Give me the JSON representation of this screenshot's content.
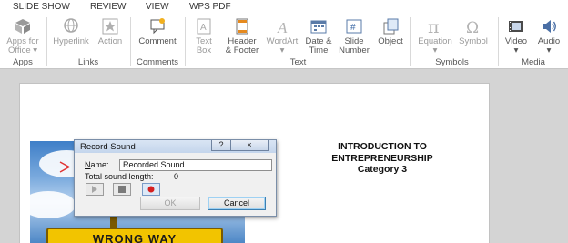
{
  "tabs": [
    "SLIDE SHOW",
    "REVIEW",
    "VIEW",
    "WPS PDF"
  ],
  "ribbon": {
    "apps": {
      "label": "Apps for Office",
      "label_line1": "Apps for",
      "label_line2": "Office",
      "arrow": "▾",
      "group": "Apps"
    },
    "links": {
      "hyperlink": "Hyperlink",
      "action": "Action",
      "group": "Links"
    },
    "comments": {
      "comment": "Comment",
      "group": "Comments"
    },
    "text": {
      "text_box_1": "Text",
      "text_box_2": "Box",
      "header_1": "Header",
      "header_2": "& Footer",
      "wordart": "WordArt",
      "wordart_arrow": "▾",
      "datetime_1": "Date &",
      "datetime_2": "Time",
      "slide_1": "Slide",
      "slide_2": "Number",
      "object": "Object",
      "group": "Text"
    },
    "symbols": {
      "equation": "Equation",
      "equation_arrow": "▾",
      "symbol": "Symbol",
      "group": "Symbols"
    },
    "media": {
      "video": "Video",
      "video_arrow": "▾",
      "audio": "Audio",
      "audio_arrow": "▾",
      "group": "Media"
    }
  },
  "slide": {
    "title_line1": "INTRODUCTION TO",
    "title_line2": "ENTREPRENEURSHIP",
    "title_line3": "Category 3",
    "sign_text": "WRONG WAY"
  },
  "dialog": {
    "title": "Record Sound",
    "help": "?",
    "close": "×",
    "name_label_u": "N",
    "name_label_rest": "ame:",
    "name_value": "Recorded Sound",
    "length_label": "Total sound length:",
    "length_value": "0",
    "ok": "OK",
    "cancel": "Cancel"
  },
  "colors": {
    "accent_red": "#e03131",
    "record_red": "#d62020"
  }
}
